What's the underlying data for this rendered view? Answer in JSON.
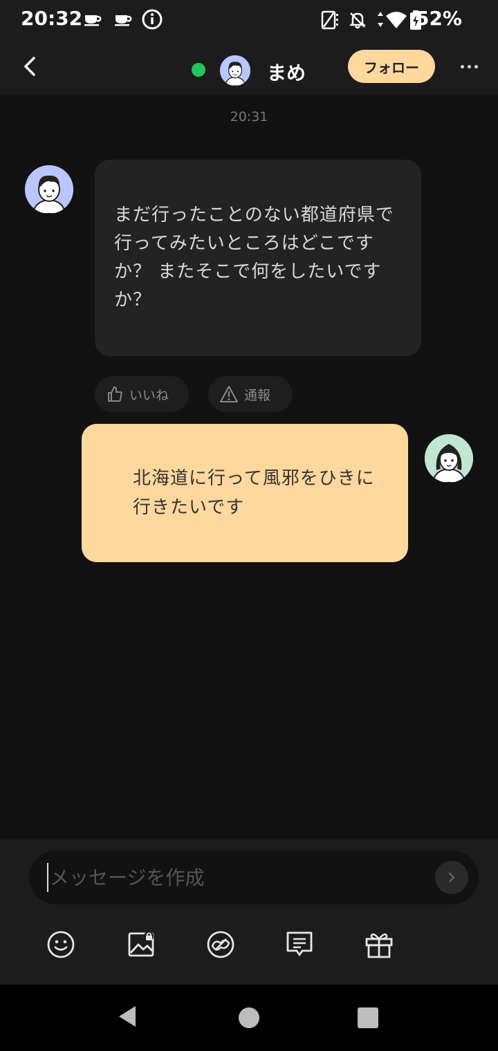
{
  "status_bar": {
    "time": "20:32",
    "battery": "52%",
    "icons": [
      "coffee-icon",
      "coffee-icon",
      "info-icon",
      "no-sim-icon",
      "bell-off-icon",
      "wifi-icon",
      "battery-icon"
    ]
  },
  "header": {
    "name": "まめ",
    "follow_label": "フォロー",
    "online_color": "#22c55e"
  },
  "chat": {
    "timestamp": "20:31",
    "messages": [
      {
        "side": "incoming",
        "text": "まだ行ったことのない都道府県で行ってみたいところはどこですか？ またそこで何をしたいですか？"
      },
      {
        "side": "outgoing",
        "text": "北海道に行って風邪をひきに行きたいです"
      }
    ],
    "actions": {
      "like_label": "いいね",
      "report_label": "通報"
    }
  },
  "composer": {
    "placeholder": "メッセージを作成",
    "value": "",
    "tools": [
      "emoji-icon",
      "image-locked-icon",
      "sticker-icon",
      "message-template-icon",
      "gift-icon"
    ]
  },
  "colors": {
    "accent": "#ffd89e",
    "background": "#121212",
    "bar": "#1c1c1c"
  }
}
